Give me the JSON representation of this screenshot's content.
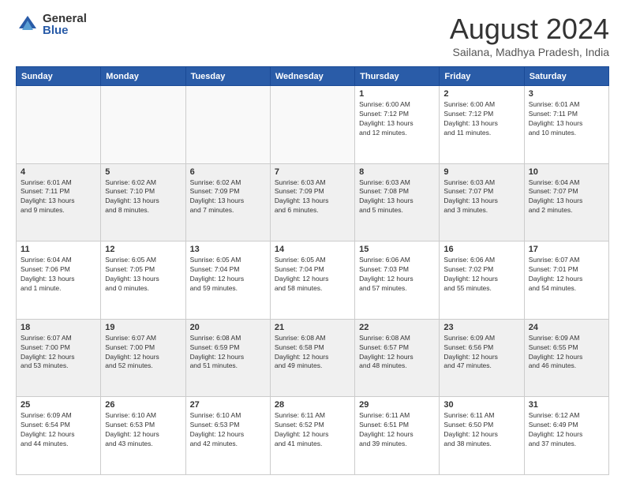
{
  "logo": {
    "general": "General",
    "blue": "Blue"
  },
  "title": "August 2024",
  "subtitle": "Sailana, Madhya Pradesh, India",
  "weekdays": [
    "Sunday",
    "Monday",
    "Tuesday",
    "Wednesday",
    "Thursday",
    "Friday",
    "Saturday"
  ],
  "weeks": [
    [
      {
        "day": "",
        "info": ""
      },
      {
        "day": "",
        "info": ""
      },
      {
        "day": "",
        "info": ""
      },
      {
        "day": "",
        "info": ""
      },
      {
        "day": "1",
        "info": "Sunrise: 6:00 AM\nSunset: 7:12 PM\nDaylight: 13 hours\nand 12 minutes."
      },
      {
        "day": "2",
        "info": "Sunrise: 6:00 AM\nSunset: 7:12 PM\nDaylight: 13 hours\nand 11 minutes."
      },
      {
        "day": "3",
        "info": "Sunrise: 6:01 AM\nSunset: 7:11 PM\nDaylight: 13 hours\nand 10 minutes."
      }
    ],
    [
      {
        "day": "4",
        "info": "Sunrise: 6:01 AM\nSunset: 7:11 PM\nDaylight: 13 hours\nand 9 minutes."
      },
      {
        "day": "5",
        "info": "Sunrise: 6:02 AM\nSunset: 7:10 PM\nDaylight: 13 hours\nand 8 minutes."
      },
      {
        "day": "6",
        "info": "Sunrise: 6:02 AM\nSunset: 7:09 PM\nDaylight: 13 hours\nand 7 minutes."
      },
      {
        "day": "7",
        "info": "Sunrise: 6:03 AM\nSunset: 7:09 PM\nDaylight: 13 hours\nand 6 minutes."
      },
      {
        "day": "8",
        "info": "Sunrise: 6:03 AM\nSunset: 7:08 PM\nDaylight: 13 hours\nand 5 minutes."
      },
      {
        "day": "9",
        "info": "Sunrise: 6:03 AM\nSunset: 7:07 PM\nDaylight: 13 hours\nand 3 minutes."
      },
      {
        "day": "10",
        "info": "Sunrise: 6:04 AM\nSunset: 7:07 PM\nDaylight: 13 hours\nand 2 minutes."
      }
    ],
    [
      {
        "day": "11",
        "info": "Sunrise: 6:04 AM\nSunset: 7:06 PM\nDaylight: 13 hours\nand 1 minute."
      },
      {
        "day": "12",
        "info": "Sunrise: 6:05 AM\nSunset: 7:05 PM\nDaylight: 13 hours\nand 0 minutes."
      },
      {
        "day": "13",
        "info": "Sunrise: 6:05 AM\nSunset: 7:04 PM\nDaylight: 12 hours\nand 59 minutes."
      },
      {
        "day": "14",
        "info": "Sunrise: 6:05 AM\nSunset: 7:04 PM\nDaylight: 12 hours\nand 58 minutes."
      },
      {
        "day": "15",
        "info": "Sunrise: 6:06 AM\nSunset: 7:03 PM\nDaylight: 12 hours\nand 57 minutes."
      },
      {
        "day": "16",
        "info": "Sunrise: 6:06 AM\nSunset: 7:02 PM\nDaylight: 12 hours\nand 55 minutes."
      },
      {
        "day": "17",
        "info": "Sunrise: 6:07 AM\nSunset: 7:01 PM\nDaylight: 12 hours\nand 54 minutes."
      }
    ],
    [
      {
        "day": "18",
        "info": "Sunrise: 6:07 AM\nSunset: 7:00 PM\nDaylight: 12 hours\nand 53 minutes."
      },
      {
        "day": "19",
        "info": "Sunrise: 6:07 AM\nSunset: 7:00 PM\nDaylight: 12 hours\nand 52 minutes."
      },
      {
        "day": "20",
        "info": "Sunrise: 6:08 AM\nSunset: 6:59 PM\nDaylight: 12 hours\nand 51 minutes."
      },
      {
        "day": "21",
        "info": "Sunrise: 6:08 AM\nSunset: 6:58 PM\nDaylight: 12 hours\nand 49 minutes."
      },
      {
        "day": "22",
        "info": "Sunrise: 6:08 AM\nSunset: 6:57 PM\nDaylight: 12 hours\nand 48 minutes."
      },
      {
        "day": "23",
        "info": "Sunrise: 6:09 AM\nSunset: 6:56 PM\nDaylight: 12 hours\nand 47 minutes."
      },
      {
        "day": "24",
        "info": "Sunrise: 6:09 AM\nSunset: 6:55 PM\nDaylight: 12 hours\nand 46 minutes."
      }
    ],
    [
      {
        "day": "25",
        "info": "Sunrise: 6:09 AM\nSunset: 6:54 PM\nDaylight: 12 hours\nand 44 minutes."
      },
      {
        "day": "26",
        "info": "Sunrise: 6:10 AM\nSunset: 6:53 PM\nDaylight: 12 hours\nand 43 minutes."
      },
      {
        "day": "27",
        "info": "Sunrise: 6:10 AM\nSunset: 6:53 PM\nDaylight: 12 hours\nand 42 minutes."
      },
      {
        "day": "28",
        "info": "Sunrise: 6:11 AM\nSunset: 6:52 PM\nDaylight: 12 hours\nand 41 minutes."
      },
      {
        "day": "29",
        "info": "Sunrise: 6:11 AM\nSunset: 6:51 PM\nDaylight: 12 hours\nand 39 minutes."
      },
      {
        "day": "30",
        "info": "Sunrise: 6:11 AM\nSunset: 6:50 PM\nDaylight: 12 hours\nand 38 minutes."
      },
      {
        "day": "31",
        "info": "Sunrise: 6:12 AM\nSunset: 6:49 PM\nDaylight: 12 hours\nand 37 minutes."
      }
    ]
  ]
}
